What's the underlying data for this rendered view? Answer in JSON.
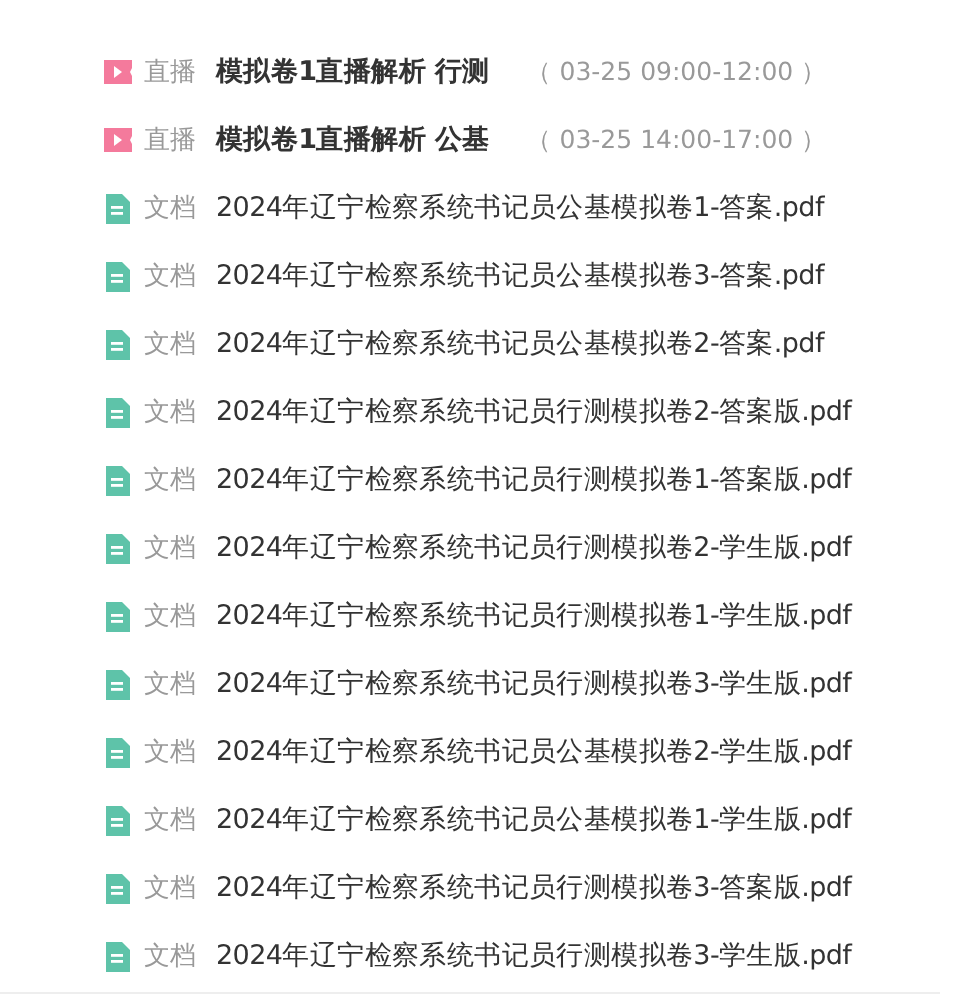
{
  "items": [
    {
      "kind": "live",
      "type_label": "直播",
      "title": "模拟卷1直播解析 行测",
      "time": "（ 03-25 09:00-12:00 ）"
    },
    {
      "kind": "live",
      "type_label": "直播",
      "title": "模拟卷1直播解析 公基",
      "time": "（ 03-25 14:00-17:00 ）"
    },
    {
      "kind": "doc",
      "type_label": "文档",
      "title": "2024年辽宁检察系统书记员公基模拟卷1-答案.pdf"
    },
    {
      "kind": "doc",
      "type_label": "文档",
      "title": "2024年辽宁检察系统书记员公基模拟卷3-答案.pdf"
    },
    {
      "kind": "doc",
      "type_label": "文档",
      "title": "2024年辽宁检察系统书记员公基模拟卷2-答案.pdf"
    },
    {
      "kind": "doc",
      "type_label": "文档",
      "title": "2024年辽宁检察系统书记员行测模拟卷2-答案版.pdf"
    },
    {
      "kind": "doc",
      "type_label": "文档",
      "title": "2024年辽宁检察系统书记员行测模拟卷1-答案版.pdf"
    },
    {
      "kind": "doc",
      "type_label": "文档",
      "title": "2024年辽宁检察系统书记员行测模拟卷2-学生版.pdf"
    },
    {
      "kind": "doc",
      "type_label": "文档",
      "title": "2024年辽宁检察系统书记员行测模拟卷1-学生版.pdf"
    },
    {
      "kind": "doc",
      "type_label": "文档",
      "title": "2024年辽宁检察系统书记员行测模拟卷3-学生版.pdf"
    },
    {
      "kind": "doc",
      "type_label": "文档",
      "title": "2024年辽宁检察系统书记员公基模拟卷2-学生版.pdf"
    },
    {
      "kind": "doc",
      "type_label": "文档",
      "title": "2024年辽宁检察系统书记员公基模拟卷1-学生版.pdf"
    },
    {
      "kind": "doc",
      "type_label": "文档",
      "title": "2024年辽宁检察系统书记员行测模拟卷3-答案版.pdf"
    },
    {
      "kind": "doc",
      "type_label": "文档",
      "title": "2024年辽宁检察系统书记员行测模拟卷3-学生版.pdf"
    }
  ]
}
